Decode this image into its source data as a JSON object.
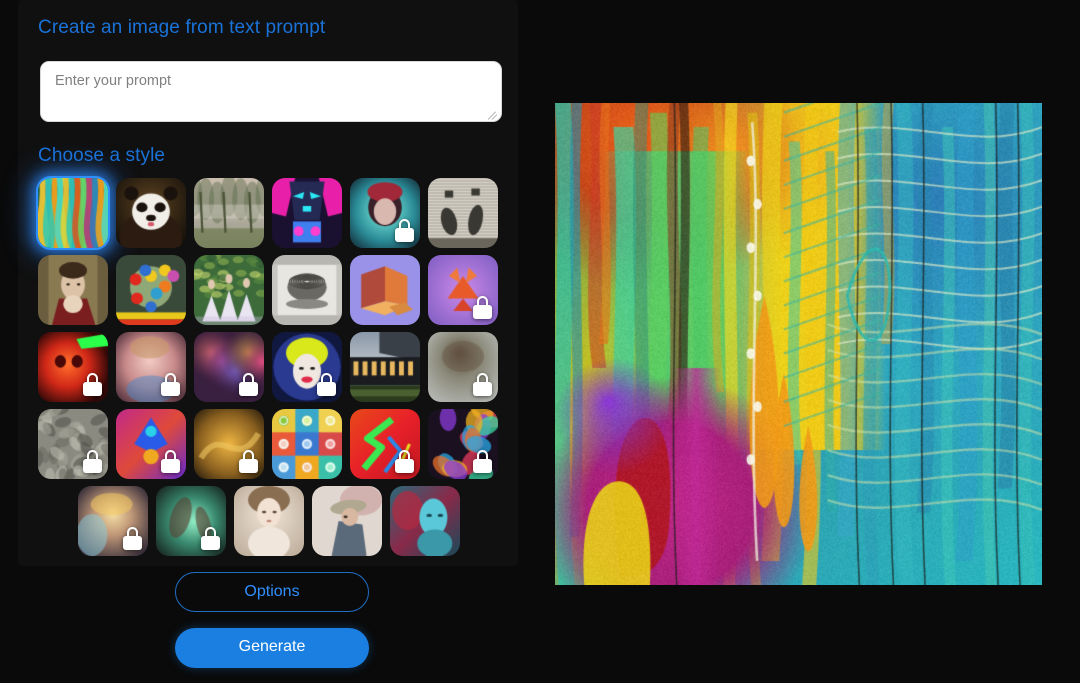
{
  "app": {
    "background": "#0a0a0a",
    "accent_blue": "#1a72d8",
    "accent_blue_bright": "#2f8fff",
    "generate_blue": "#1a7fe0"
  },
  "headings": {
    "prompt": "Create an image from text prompt",
    "style": "Choose a style"
  },
  "prompt": {
    "placeholder": "Enter your prompt",
    "value": "",
    "resize_grip_icon": "resize-grip-icon"
  },
  "buttons": {
    "options": "Options",
    "generate": "Generate"
  },
  "style_grid": {
    "selected_index": 0,
    "lock_icon": "lock-icon",
    "rows": [
      {
        "centered": false,
        "tiles": [
          {
            "name": "abstract-expressionist",
            "locked": false,
            "selected": true
          },
          {
            "name": "panda-photoreal",
            "locked": false,
            "selected": false
          },
          {
            "name": "misty-landscape-painting",
            "locked": false,
            "selected": false
          },
          {
            "name": "cyberpunk-robot",
            "locked": false,
            "selected": false
          },
          {
            "name": "neon-portrait",
            "locked": true,
            "selected": false
          },
          {
            "name": "vintage-engraving",
            "locked": false,
            "selected": false
          }
        ]
      },
      {
        "centered": false,
        "tiles": [
          {
            "name": "renaissance-portrait",
            "locked": false,
            "selected": false
          },
          {
            "name": "still-life-flowers",
            "locked": false,
            "selected": false
          },
          {
            "name": "impressionist-ballet",
            "locked": false,
            "selected": false
          },
          {
            "name": "engraved-teacup",
            "locked": false,
            "selected": false
          },
          {
            "name": "isometric-3d-render",
            "locked": false,
            "selected": false
          },
          {
            "name": "low-poly-fox",
            "locked": true,
            "selected": false
          }
        ]
      },
      {
        "centered": false,
        "tiles": [
          {
            "name": "infrared-skull",
            "locked": true,
            "selected": false
          },
          {
            "name": "soft-pastel-portrait",
            "locked": true,
            "selected": false
          },
          {
            "name": "color-smoke-abstract",
            "locked": true,
            "selected": false
          },
          {
            "name": "pop-art-icon",
            "locked": true,
            "selected": false
          },
          {
            "name": "modern-architecture",
            "locked": false,
            "selected": false
          },
          {
            "name": "macro-blur",
            "locked": true,
            "selected": false
          }
        ]
      },
      {
        "centered": false,
        "tiles": [
          {
            "name": "stone-texture",
            "locked": true,
            "selected": false
          },
          {
            "name": "psychedelic-figure",
            "locked": true,
            "selected": false
          },
          {
            "name": "golden-abstract",
            "locked": true,
            "selected": false
          },
          {
            "name": "app-icon-set",
            "locked": false,
            "selected": false
          },
          {
            "name": "neon-dragon",
            "locked": true,
            "selected": false
          },
          {
            "name": "vivid-collage",
            "locked": true,
            "selected": false
          }
        ]
      },
      {
        "centered": true,
        "tiles": [
          {
            "name": "ethereal-face",
            "locked": true,
            "selected": false
          },
          {
            "name": "green-mist-figure",
            "locked": true,
            "selected": false
          },
          {
            "name": "porcelain-doll-portrait",
            "locked": false,
            "selected": false
          },
          {
            "name": "painter-with-hat",
            "locked": false,
            "selected": false
          },
          {
            "name": "teal-red-portrait",
            "locked": false,
            "selected": false
          }
        ]
      }
    ]
  },
  "result": {
    "name": "generated-image",
    "description": "Abstract expressionist painting with vertical flowing strokes of yellow, teal, orange, magenta and green",
    "palette": [
      "#f2cb1a",
      "#2fc4b6",
      "#e8821f",
      "#c0258a",
      "#5fd16a",
      "#1f7fa8",
      "#b51d2a"
    ]
  }
}
